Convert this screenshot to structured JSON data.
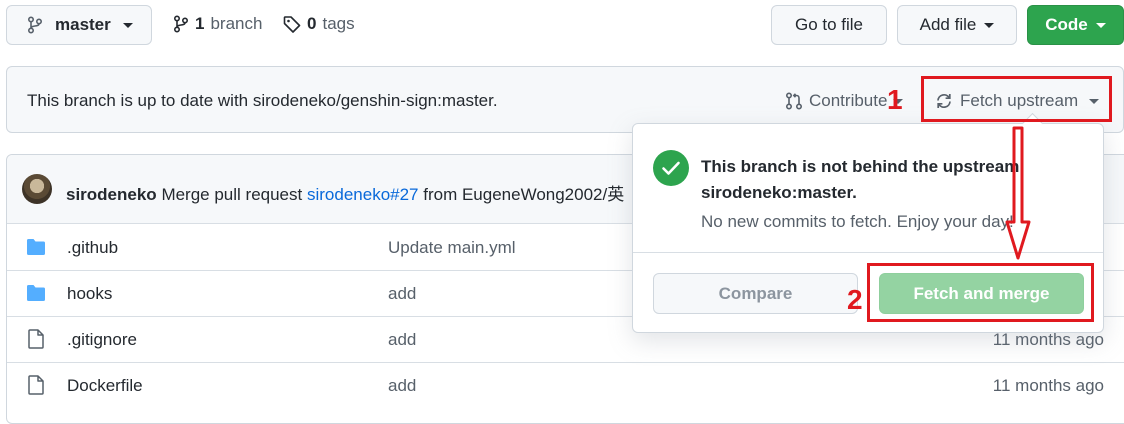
{
  "top": {
    "branch_label": "master",
    "branch_count": "1",
    "branch_word": "branch",
    "tag_count": "0",
    "tag_word": "tags",
    "go_to_file": "Go to file",
    "add_file": "Add file",
    "code": "Code"
  },
  "banner": {
    "status": "This branch is up to date with sirodeneko/genshin-sign:master.",
    "contribute": "Contribute",
    "fetch_upstream": "Fetch upstream"
  },
  "commit": {
    "author": "sirodeneko",
    "message_pre": "Merge pull request",
    "pr_link": "sirodeneko#27",
    "message_post": "from EugeneWong2002/英"
  },
  "files": [
    {
      "type": "folder",
      "name": ".github",
      "msg": "Update main.yml",
      "age": ""
    },
    {
      "type": "folder",
      "name": "hooks",
      "msg": "add",
      "age": ""
    },
    {
      "type": "file",
      "name": ".gitignore",
      "msg": "add",
      "age": "11 months ago"
    },
    {
      "type": "file",
      "name": "Dockerfile",
      "msg": "add",
      "age": "11 months ago"
    }
  ],
  "popover": {
    "title_line1": "This branch is not behind the upstream",
    "title_line2": "sirodeneko:master.",
    "subtitle": "No new commits to fetch. Enjoy your day!",
    "compare": "Compare",
    "fetch_merge": "Fetch and merge"
  },
  "annotations": {
    "label1": "1",
    "label2": "2",
    "color": "#e0191f"
  },
  "colors": {
    "code_button": "#2da44e",
    "fetch_merge_disabled": "#94d3a2",
    "folder_icon": "#54aeff",
    "link": "#0969da"
  }
}
